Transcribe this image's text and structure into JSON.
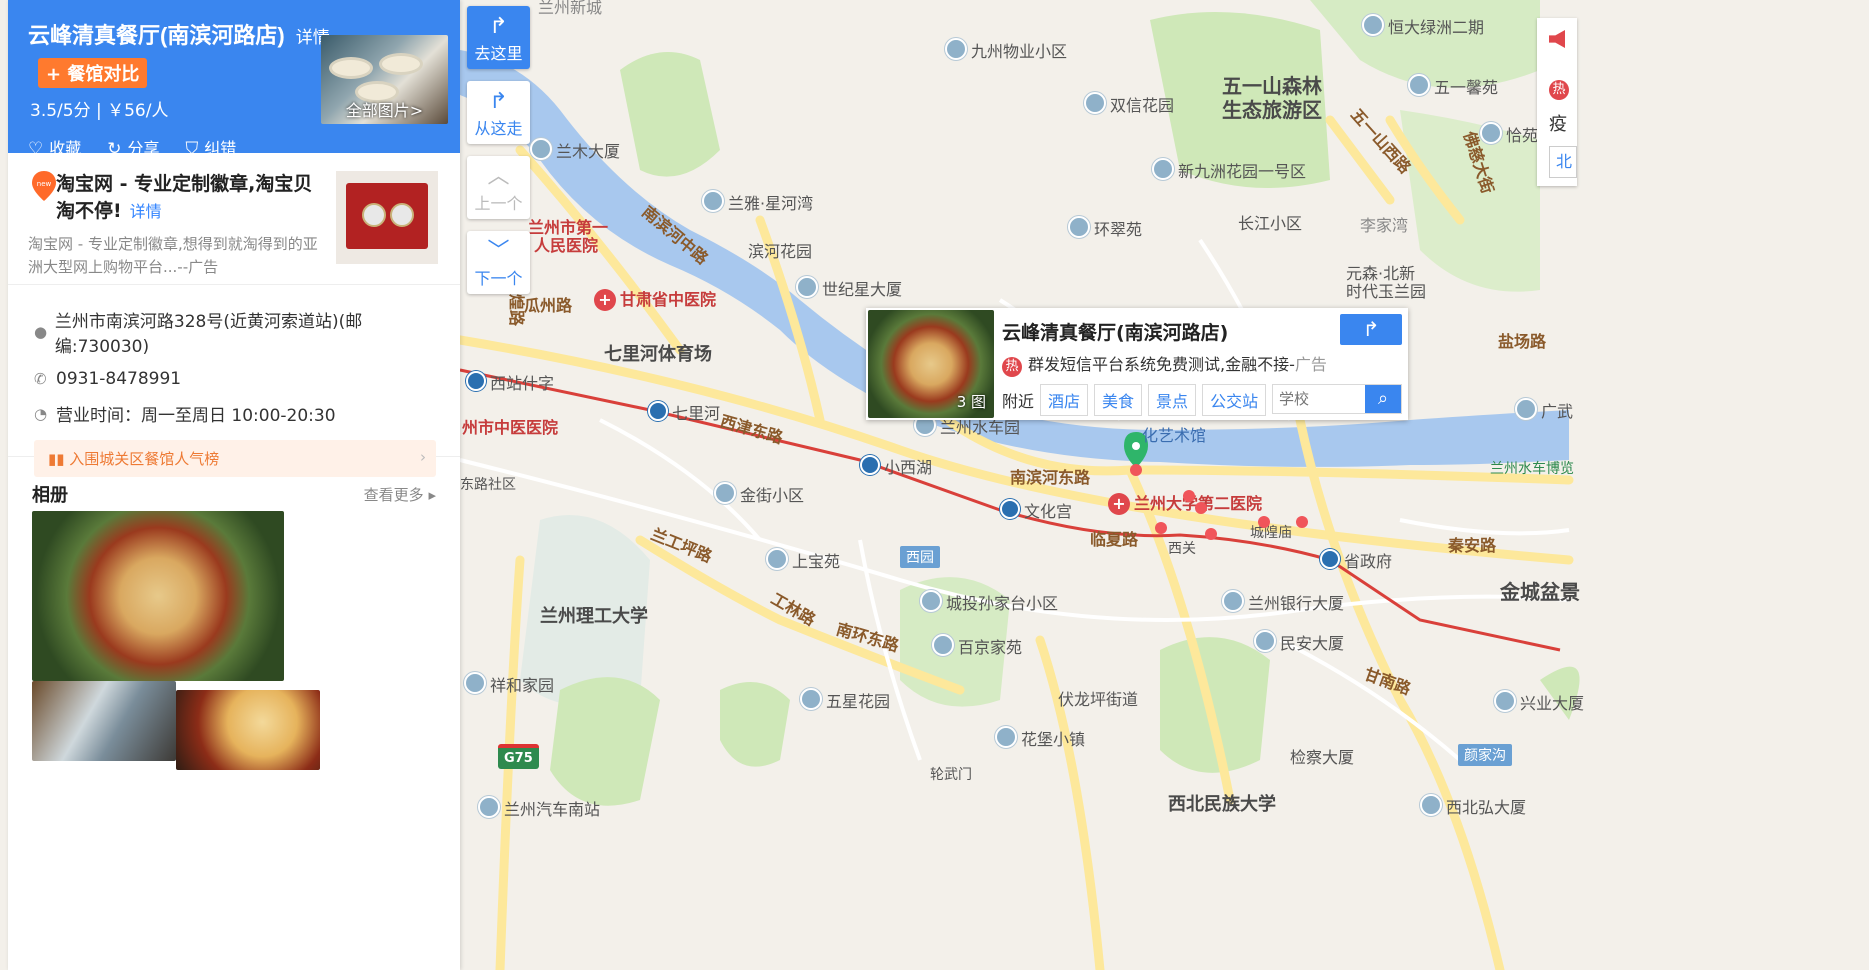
{
  "place": {
    "title": "云峰清真餐厅(南滨河路店)",
    "detail_link": "详情",
    "compare_button": "+ 餐馆对比",
    "rating": "3.5/5分 | ￥56/人",
    "photo_label": "全部图片>",
    "actions": {
      "favorite": "收藏",
      "share": "分享",
      "report": "纠错"
    }
  },
  "ad": {
    "title": "淘宝网 - 专业定制徽章,淘宝贝 淘不停!",
    "detail": "详情",
    "desc": "淘宝网 - 专业定制徽章,想得到就淘得到的亚洲大型网上购物平台...--广告"
  },
  "info": {
    "address": "兰州市南滨河路328号(近黄河索道站)(邮编:730030)",
    "phone": "0931-8478991",
    "hours": "营业时间：周一至周日 10:00-20:30",
    "rank_banner": "入围城关区餐馆人气榜"
  },
  "album": {
    "title": "相册",
    "more": "查看更多"
  },
  "nav": {
    "go_here": "去这里",
    "from_here": "从这走",
    "prev": "上一个",
    "next": "下一个"
  },
  "popup": {
    "title": "云峰清真餐厅(南滨河路店)",
    "photo_count": "3 图",
    "ad_text": "群发短信平台系统免费测试,金融不接-",
    "ad_suffix": "广告",
    "nearby_label": "附近",
    "chips": [
      "酒店",
      "美食",
      "景点",
      "公交站"
    ],
    "search_placeholder": "学校"
  },
  "right_widget": {
    "hot": "热",
    "text": "疫",
    "input": "北"
  },
  "map_labels": [
    {
      "text": "恒大绿洲二期",
      "kind": "poi"
    },
    {
      "text": "九州物业小区",
      "kind": "poi"
    },
    {
      "text": "五一山森林",
      "kind": "big"
    },
    {
      "text": "生态旅游区",
      "kind": "big"
    },
    {
      "text": "五一馨苑",
      "kind": "poi"
    },
    {
      "text": "双信花园",
      "kind": "poi"
    },
    {
      "text": "恰苑",
      "kind": "poi"
    },
    {
      "text": "兰州新城",
      "kind": "plain"
    },
    {
      "text": "兰木大厦",
      "kind": "poi"
    },
    {
      "text": "五一山西路",
      "kind": "road"
    },
    {
      "text": "新九洲花园一号区",
      "kind": "poi"
    },
    {
      "text": "佛慈大街",
      "kind": "road"
    },
    {
      "text": "兰雅·星河湾",
      "kind": "poi"
    },
    {
      "text": "环翠苑",
      "kind": "poi"
    },
    {
      "text": "长江小区",
      "kind": "plain"
    },
    {
      "text": "李家湾",
      "kind": "plain"
    },
    {
      "text": "兰州市第一",
      "kind": "red"
    },
    {
      "text": "人民医院",
      "kind": "red"
    },
    {
      "text": "南滨河中路",
      "kind": "road"
    },
    {
      "text": "滨河花园",
      "kind": "plain"
    },
    {
      "text": "元森·北新",
      "kind": "plain"
    },
    {
      "text": "时代玉兰园",
      "kind": "plain"
    },
    {
      "text": "甘肃省中医院",
      "kind": "red"
    },
    {
      "text": "世纪星大厦",
      "kind": "poi"
    },
    {
      "text": "瓜州路",
      "kind": "road"
    },
    {
      "text": "敦煌路",
      "kind": "road"
    },
    {
      "text": "盐场路",
      "kind": "road"
    },
    {
      "text": "七里河体育场",
      "kind": "big"
    },
    {
      "text": "西站什字",
      "kind": "station"
    },
    {
      "text": "七里河",
      "kind": "station"
    },
    {
      "text": "西津东路",
      "kind": "road"
    },
    {
      "text": "兰州水车园",
      "kind": "poi"
    },
    {
      "text": "化艺术馆",
      "kind": "plain"
    },
    {
      "text": "广武",
      "kind": "poi"
    },
    {
      "text": "州市中医医院",
      "kind": "red"
    },
    {
      "text": "小西湖",
      "kind": "station"
    },
    {
      "text": "南滨河东路",
      "kind": "road"
    },
    {
      "text": "兰州水车博览",
      "kind": "plain"
    },
    {
      "text": "东路社区",
      "kind": "plain"
    },
    {
      "text": "金街小区",
      "kind": "poi"
    },
    {
      "text": "文化宫",
      "kind": "station"
    },
    {
      "text": "兰州大学第二医院",
      "kind": "red"
    },
    {
      "text": "临夏路",
      "kind": "road"
    },
    {
      "text": "西关",
      "kind": "plain"
    },
    {
      "text": "城隍庙",
      "kind": "plain"
    },
    {
      "text": "秦安路",
      "kind": "road"
    },
    {
      "text": "兰工坪路",
      "kind": "road"
    },
    {
      "text": "西园",
      "kind": "badge"
    },
    {
      "text": "上宝苑",
      "kind": "poi"
    },
    {
      "text": "省政府",
      "kind": "station"
    },
    {
      "text": "金城盆景",
      "kind": "big"
    },
    {
      "text": "兰州理工大学",
      "kind": "big"
    },
    {
      "text": "城投孙家台小区",
      "kind": "poi"
    },
    {
      "text": "兰州银行大厦",
      "kind": "poi"
    },
    {
      "text": "工林路",
      "kind": "road"
    },
    {
      "text": "南环东路",
      "kind": "road"
    },
    {
      "text": "百京家苑",
      "kind": "poi"
    },
    {
      "text": "民安大厦",
      "kind": "poi"
    },
    {
      "text": "甘南路",
      "kind": "road"
    },
    {
      "text": "祥和家园",
      "kind": "poi"
    },
    {
      "text": "五星花园",
      "kind": "poi"
    },
    {
      "text": "伏龙坪街道",
      "kind": "plain"
    },
    {
      "text": "兴业大厦",
      "kind": "poi"
    },
    {
      "text": "花堡小镇",
      "kind": "poi"
    },
    {
      "text": "G75",
      "kind": "shield"
    },
    {
      "text": "检察大厦",
      "kind": "plain"
    },
    {
      "text": "颜家沟",
      "kind": "badge"
    },
    {
      "text": "轮武门",
      "kind": "plain"
    },
    {
      "text": "兰州汽车南站",
      "kind": "poi"
    },
    {
      "text": "西北民族大学",
      "kind": "big"
    },
    {
      "text": "西北弘大厦",
      "kind": "poi"
    }
  ],
  "colors": {
    "accent": "#3a86ef",
    "compare_orange": "#ff7a2e",
    "river": "#a8c8ee",
    "park": "#cfe8b8",
    "metro_line": "#d9403a",
    "road": "#fde89b"
  }
}
